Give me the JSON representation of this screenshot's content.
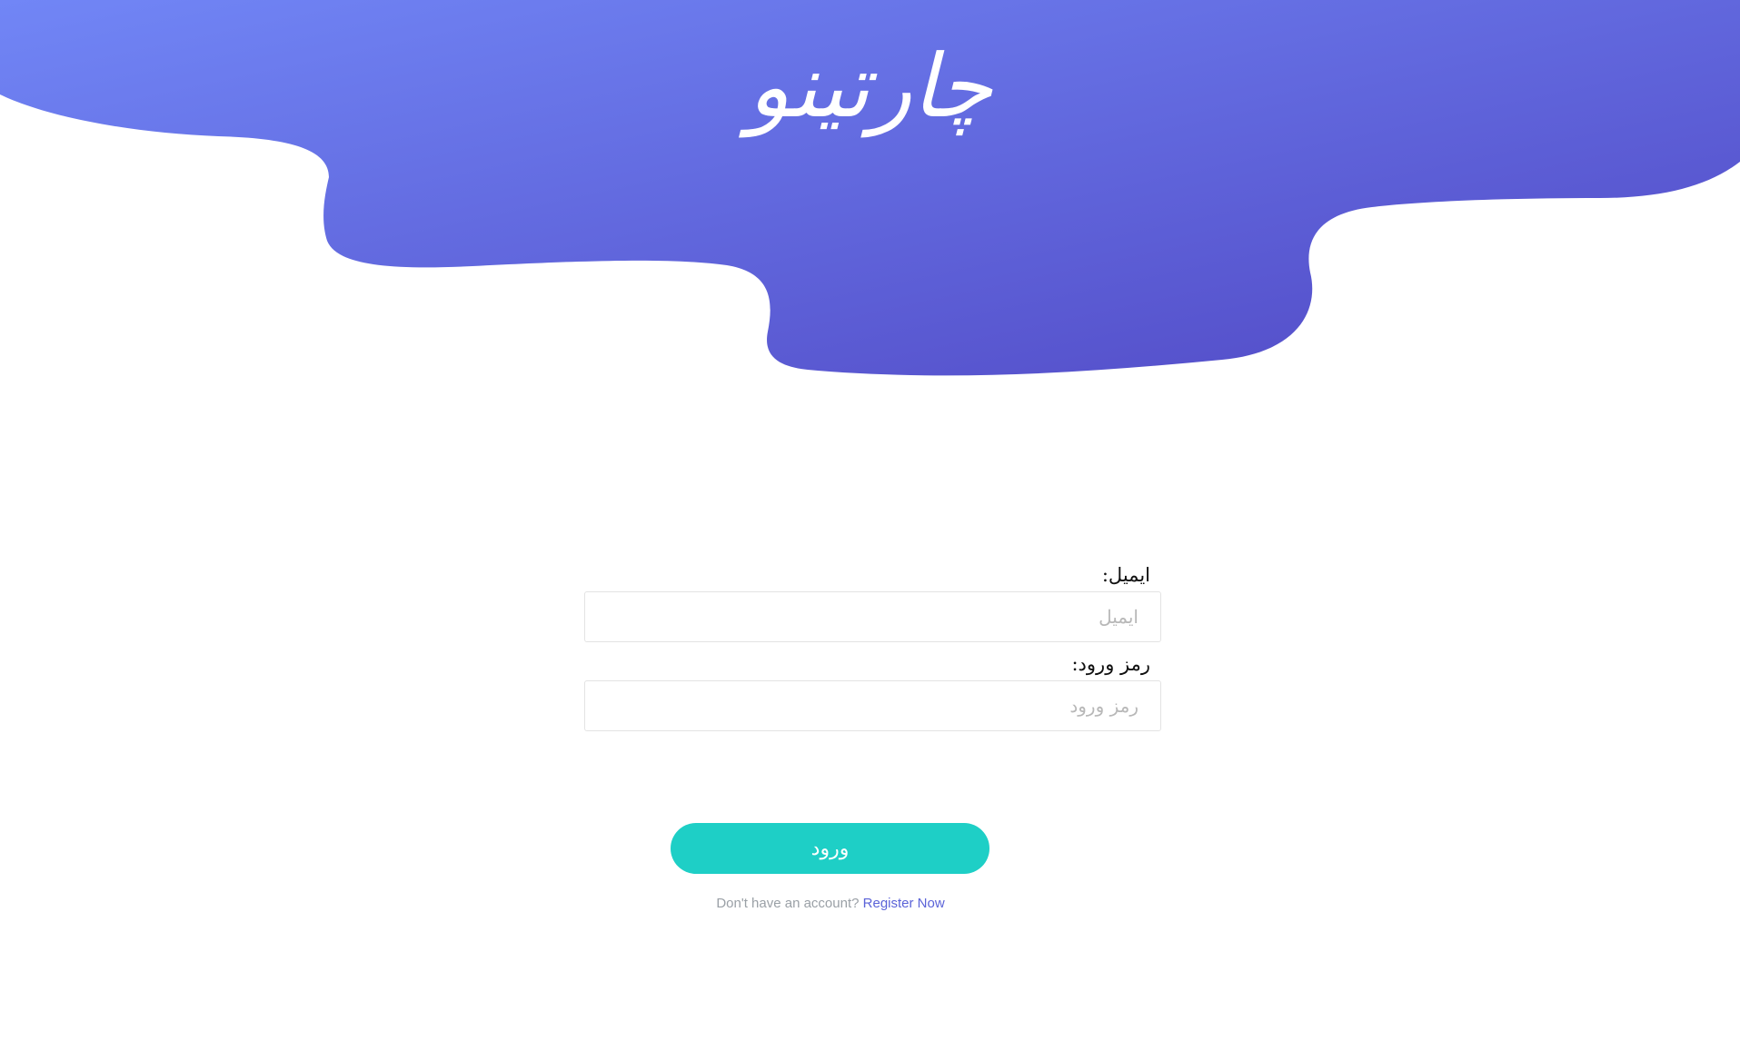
{
  "brand": {
    "title": "چارتینو"
  },
  "login_form": {
    "email_label": "ایمیل:",
    "email_placeholder": "ایمیل",
    "email_value": "",
    "password_label": "رمز ورود:",
    "password_placeholder": "رمز ورود",
    "password_value": "",
    "submit_label": "ورود"
  },
  "footer": {
    "prompt": "Don't have an account?",
    "register_link": "Register Now"
  },
  "colors": {
    "gradient_start": "#7186f6",
    "gradient_end": "#5148c4",
    "button": "#1ecfc6",
    "link": "#5b63d8"
  }
}
